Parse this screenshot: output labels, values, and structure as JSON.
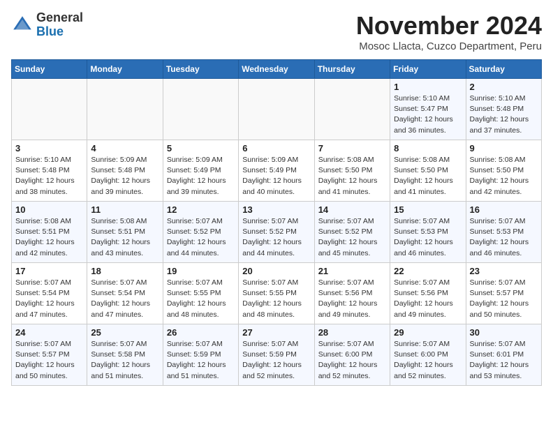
{
  "header": {
    "logo_line1": "General",
    "logo_line2": "Blue",
    "title": "November 2024",
    "subtitle": "Mosoc Llacta, Cuzco Department, Peru"
  },
  "weekdays": [
    "Sunday",
    "Monday",
    "Tuesday",
    "Wednesday",
    "Thursday",
    "Friday",
    "Saturday"
  ],
  "weeks": [
    [
      {
        "day": "",
        "info": ""
      },
      {
        "day": "",
        "info": ""
      },
      {
        "day": "",
        "info": ""
      },
      {
        "day": "",
        "info": ""
      },
      {
        "day": "",
        "info": ""
      },
      {
        "day": "1",
        "info": "Sunrise: 5:10 AM\nSunset: 5:47 PM\nDaylight: 12 hours\nand 36 minutes."
      },
      {
        "day": "2",
        "info": "Sunrise: 5:10 AM\nSunset: 5:48 PM\nDaylight: 12 hours\nand 37 minutes."
      }
    ],
    [
      {
        "day": "3",
        "info": "Sunrise: 5:10 AM\nSunset: 5:48 PM\nDaylight: 12 hours\nand 38 minutes."
      },
      {
        "day": "4",
        "info": "Sunrise: 5:09 AM\nSunset: 5:48 PM\nDaylight: 12 hours\nand 39 minutes."
      },
      {
        "day": "5",
        "info": "Sunrise: 5:09 AM\nSunset: 5:49 PM\nDaylight: 12 hours\nand 39 minutes."
      },
      {
        "day": "6",
        "info": "Sunrise: 5:09 AM\nSunset: 5:49 PM\nDaylight: 12 hours\nand 40 minutes."
      },
      {
        "day": "7",
        "info": "Sunrise: 5:08 AM\nSunset: 5:50 PM\nDaylight: 12 hours\nand 41 minutes."
      },
      {
        "day": "8",
        "info": "Sunrise: 5:08 AM\nSunset: 5:50 PM\nDaylight: 12 hours\nand 41 minutes."
      },
      {
        "day": "9",
        "info": "Sunrise: 5:08 AM\nSunset: 5:50 PM\nDaylight: 12 hours\nand 42 minutes."
      }
    ],
    [
      {
        "day": "10",
        "info": "Sunrise: 5:08 AM\nSunset: 5:51 PM\nDaylight: 12 hours\nand 42 minutes."
      },
      {
        "day": "11",
        "info": "Sunrise: 5:08 AM\nSunset: 5:51 PM\nDaylight: 12 hours\nand 43 minutes."
      },
      {
        "day": "12",
        "info": "Sunrise: 5:07 AM\nSunset: 5:52 PM\nDaylight: 12 hours\nand 44 minutes."
      },
      {
        "day": "13",
        "info": "Sunrise: 5:07 AM\nSunset: 5:52 PM\nDaylight: 12 hours\nand 44 minutes."
      },
      {
        "day": "14",
        "info": "Sunrise: 5:07 AM\nSunset: 5:52 PM\nDaylight: 12 hours\nand 45 minutes."
      },
      {
        "day": "15",
        "info": "Sunrise: 5:07 AM\nSunset: 5:53 PM\nDaylight: 12 hours\nand 46 minutes."
      },
      {
        "day": "16",
        "info": "Sunrise: 5:07 AM\nSunset: 5:53 PM\nDaylight: 12 hours\nand 46 minutes."
      }
    ],
    [
      {
        "day": "17",
        "info": "Sunrise: 5:07 AM\nSunset: 5:54 PM\nDaylight: 12 hours\nand 47 minutes."
      },
      {
        "day": "18",
        "info": "Sunrise: 5:07 AM\nSunset: 5:54 PM\nDaylight: 12 hours\nand 47 minutes."
      },
      {
        "day": "19",
        "info": "Sunrise: 5:07 AM\nSunset: 5:55 PM\nDaylight: 12 hours\nand 48 minutes."
      },
      {
        "day": "20",
        "info": "Sunrise: 5:07 AM\nSunset: 5:55 PM\nDaylight: 12 hours\nand 48 minutes."
      },
      {
        "day": "21",
        "info": "Sunrise: 5:07 AM\nSunset: 5:56 PM\nDaylight: 12 hours\nand 49 minutes."
      },
      {
        "day": "22",
        "info": "Sunrise: 5:07 AM\nSunset: 5:56 PM\nDaylight: 12 hours\nand 49 minutes."
      },
      {
        "day": "23",
        "info": "Sunrise: 5:07 AM\nSunset: 5:57 PM\nDaylight: 12 hours\nand 50 minutes."
      }
    ],
    [
      {
        "day": "24",
        "info": "Sunrise: 5:07 AM\nSunset: 5:57 PM\nDaylight: 12 hours\nand 50 minutes."
      },
      {
        "day": "25",
        "info": "Sunrise: 5:07 AM\nSunset: 5:58 PM\nDaylight: 12 hours\nand 51 minutes."
      },
      {
        "day": "26",
        "info": "Sunrise: 5:07 AM\nSunset: 5:59 PM\nDaylight: 12 hours\nand 51 minutes."
      },
      {
        "day": "27",
        "info": "Sunrise: 5:07 AM\nSunset: 5:59 PM\nDaylight: 12 hours\nand 52 minutes."
      },
      {
        "day": "28",
        "info": "Sunrise: 5:07 AM\nSunset: 6:00 PM\nDaylight: 12 hours\nand 52 minutes."
      },
      {
        "day": "29",
        "info": "Sunrise: 5:07 AM\nSunset: 6:00 PM\nDaylight: 12 hours\nand 52 minutes."
      },
      {
        "day": "30",
        "info": "Sunrise: 5:07 AM\nSunset: 6:01 PM\nDaylight: 12 hours\nand 53 minutes."
      }
    ]
  ]
}
